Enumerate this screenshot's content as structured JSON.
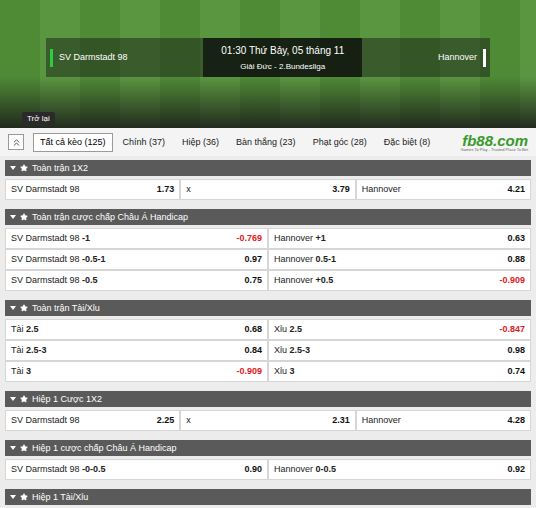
{
  "match": {
    "home": "SV Darmstadt 98",
    "away": "Hannover",
    "time": "01:30 Thứ Bảy, 05 tháng 11",
    "league": "Giải Đức - 2.Bundesliga"
  },
  "back_button": "Trở lại",
  "tabs": [
    {
      "label": "Tất cả kèo (125)",
      "selected": true
    },
    {
      "label": "Chính (37)",
      "selected": false
    },
    {
      "label": "Hiệp (36)",
      "selected": false
    },
    {
      "label": "Bàn thắng (23)",
      "selected": false
    },
    {
      "label": "Phạt góc (28)",
      "selected": false
    },
    {
      "label": "Đặc biệt (8)",
      "selected": false
    }
  ],
  "logo": {
    "text": "fb88.com",
    "tagline": "Games To Play - Trusted Place To Bet"
  },
  "sections": [
    {
      "title": "Toàn trận 1X2",
      "rows": [
        [
          {
            "label": "SV Darmstadt 98",
            "line": "",
            "odds": "1.73",
            "negative": false
          },
          {
            "label": "x",
            "line": "",
            "odds": "3.79",
            "negative": false
          },
          {
            "label": "Hannover",
            "line": "",
            "odds": "4.21",
            "negative": false
          }
        ]
      ]
    },
    {
      "title": "Toàn trận cược chấp Châu Á Handicap",
      "rows": [
        [
          {
            "label": "SV Darmstadt 98",
            "line": "-1",
            "odds": "-0.769",
            "negative": true
          },
          {
            "label": "Hannover",
            "line": "+1",
            "odds": "0.63",
            "negative": false
          }
        ],
        [
          {
            "label": "SV Darmstadt 98",
            "line": "-0.5-1",
            "odds": "0.97",
            "negative": false
          },
          {
            "label": "Hannover",
            "line": "0.5-1",
            "odds": "0.88",
            "negative": false
          }
        ],
        [
          {
            "label": "SV Darmstadt 98",
            "line": "-0.5",
            "odds": "0.75",
            "negative": false
          },
          {
            "label": "Hannover",
            "line": "+0.5",
            "odds": "-0.909",
            "negative": true
          }
        ]
      ]
    },
    {
      "title": "Toàn trận Tài/Xỉu",
      "rows": [
        [
          {
            "label": "Tài",
            "line": "2.5",
            "odds": "0.68",
            "negative": false
          },
          {
            "label": "Xỉu",
            "line": "2.5",
            "odds": "-0.847",
            "negative": true
          }
        ],
        [
          {
            "label": "Tài",
            "line": "2.5-3",
            "odds": "0.84",
            "negative": false
          },
          {
            "label": "Xỉu",
            "line": "2.5-3",
            "odds": "0.98",
            "negative": false
          }
        ],
        [
          {
            "label": "Tài",
            "line": "3",
            "odds": "-0.909",
            "negative": true
          },
          {
            "label": "Xỉu",
            "line": "3",
            "odds": "0.74",
            "negative": false
          }
        ]
      ]
    },
    {
      "title": "Hiệp 1 Cược 1X2",
      "rows": [
        [
          {
            "label": "SV Darmstadt 98",
            "line": "",
            "odds": "2.25",
            "negative": false
          },
          {
            "label": "x",
            "line": "",
            "odds": "2.31",
            "negative": false
          },
          {
            "label": "Hannover",
            "line": "",
            "odds": "4.28",
            "negative": false
          }
        ]
      ]
    },
    {
      "title": "Hiệp 1 cược chấp Châu Á Handicap",
      "rows": [
        [
          {
            "label": "SV Darmstadt 98",
            "line": "-0-0.5",
            "odds": "0.90",
            "negative": false
          },
          {
            "label": "Hannover",
            "line": "0-0.5",
            "odds": "0.92",
            "negative": false
          }
        ]
      ]
    },
    {
      "title": "Hiệp 1 Tài/Xỉu",
      "rows": []
    }
  ]
}
